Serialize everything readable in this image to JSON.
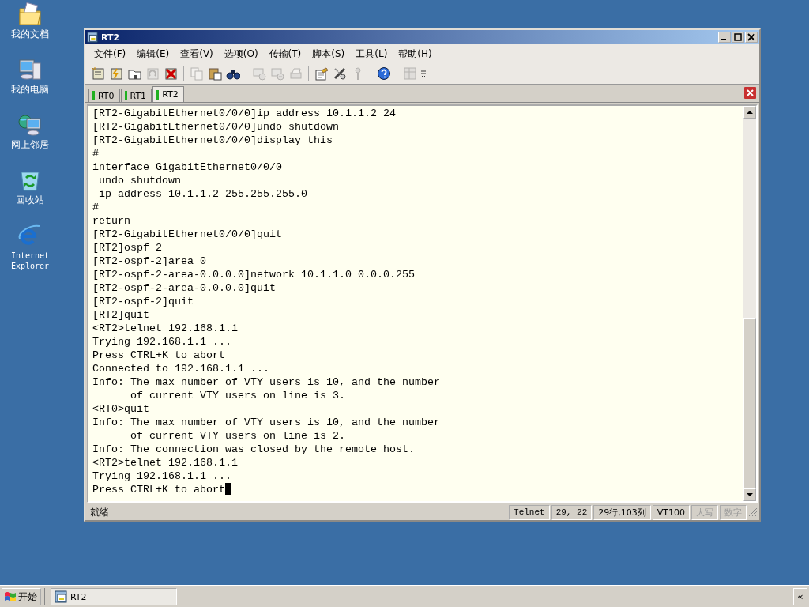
{
  "desktop_icons": [
    {
      "kind": "documents",
      "label": "我的文档"
    },
    {
      "kind": "computer",
      "label": "我的电脑"
    },
    {
      "kind": "network",
      "label": "网上邻居"
    },
    {
      "kind": "recycle",
      "label": "回收站"
    },
    {
      "kind": "browser",
      "label": "Internet Explorer"
    }
  ],
  "window": {
    "title": "RT2"
  },
  "menu": [
    "文件(F)",
    "编辑(E)",
    "查看(V)",
    "选项(O)",
    "传输(T)",
    "脚本(S)",
    "工具(L)",
    "帮助(H)"
  ],
  "toolbar": [
    {
      "kind": "connect",
      "disabled": false
    },
    {
      "kind": "quick",
      "disabled": false
    },
    {
      "kind": "folder",
      "disabled": false
    },
    {
      "kind": "reconnect",
      "disabled": true
    },
    {
      "kind": "disconnect",
      "disabled": false
    },
    {
      "kind": "sep"
    },
    {
      "kind": "copy",
      "disabled": true
    },
    {
      "kind": "paste",
      "disabled": false
    },
    {
      "kind": "find",
      "disabled": false
    },
    {
      "kind": "sep"
    },
    {
      "kind": "send",
      "disabled": true
    },
    {
      "kind": "receive",
      "disabled": true
    },
    {
      "kind": "print",
      "disabled": true
    },
    {
      "kind": "sep"
    },
    {
      "kind": "options",
      "disabled": false
    },
    {
      "kind": "settings",
      "disabled": false
    },
    {
      "kind": "key",
      "disabled": true
    },
    {
      "kind": "sep"
    },
    {
      "kind": "help",
      "disabled": false
    },
    {
      "kind": "sep"
    },
    {
      "kind": "map",
      "disabled": true
    }
  ],
  "tabs": [
    {
      "label": "RT0",
      "selected": false
    },
    {
      "label": "RT1",
      "selected": false
    },
    {
      "label": "RT2",
      "selected": true
    }
  ],
  "terminal": {
    "lines": [
      "[RT2-GigabitEthernet0/0/0]ip address 10.1.1.2 24",
      "[RT2-GigabitEthernet0/0/0]undo shutdown",
      "[RT2-GigabitEthernet0/0/0]display this",
      "#",
      "interface GigabitEthernet0/0/0",
      " undo shutdown",
      " ip address 10.1.1.2 255.255.255.0",
      "#",
      "return",
      "[RT2-GigabitEthernet0/0/0]quit",
      "[RT2]ospf 2",
      "[RT2-ospf-2]area 0",
      "[RT2-ospf-2-area-0.0.0.0]network 10.1.1.0 0.0.0.255",
      "[RT2-ospf-2-area-0.0.0.0]quit",
      "[RT2-ospf-2]quit",
      "[RT2]quit",
      "<RT2>telnet 192.168.1.1",
      "Trying 192.168.1.1 ...",
      "Press CTRL+K to abort",
      "Connected to 192.168.1.1 ...",
      "Info: The max number of VTY users is 10, and the number",
      "      of current VTY users on line is 3.",
      "<RT0>quit",
      "Info: The max number of VTY users is 10, and the number",
      "      of current VTY users on line is 2.",
      "Info: The connection was closed by the remote host.",
      "<RT2>telnet 192.168.1.1",
      "Trying 192.168.1.1 ...",
      "Press CTRL+K to abort"
    ],
    "cursor": true
  },
  "status_bar": {
    "message": "就绪",
    "panes": [
      {
        "text": "Telnet",
        "disabled": false
      },
      {
        "text": "29,  22",
        "disabled": false
      },
      {
        "text": "29行,103列",
        "disabled": false
      },
      {
        "text": "VT100",
        "disabled": false
      },
      {
        "text": "大写",
        "disabled": true
      },
      {
        "text": "数字",
        "disabled": true
      }
    ]
  },
  "taskbar": {
    "start": "开始",
    "tasks": [
      {
        "label": "RT2",
        "selected": true
      }
    ],
    "tray_button": "«"
  }
}
